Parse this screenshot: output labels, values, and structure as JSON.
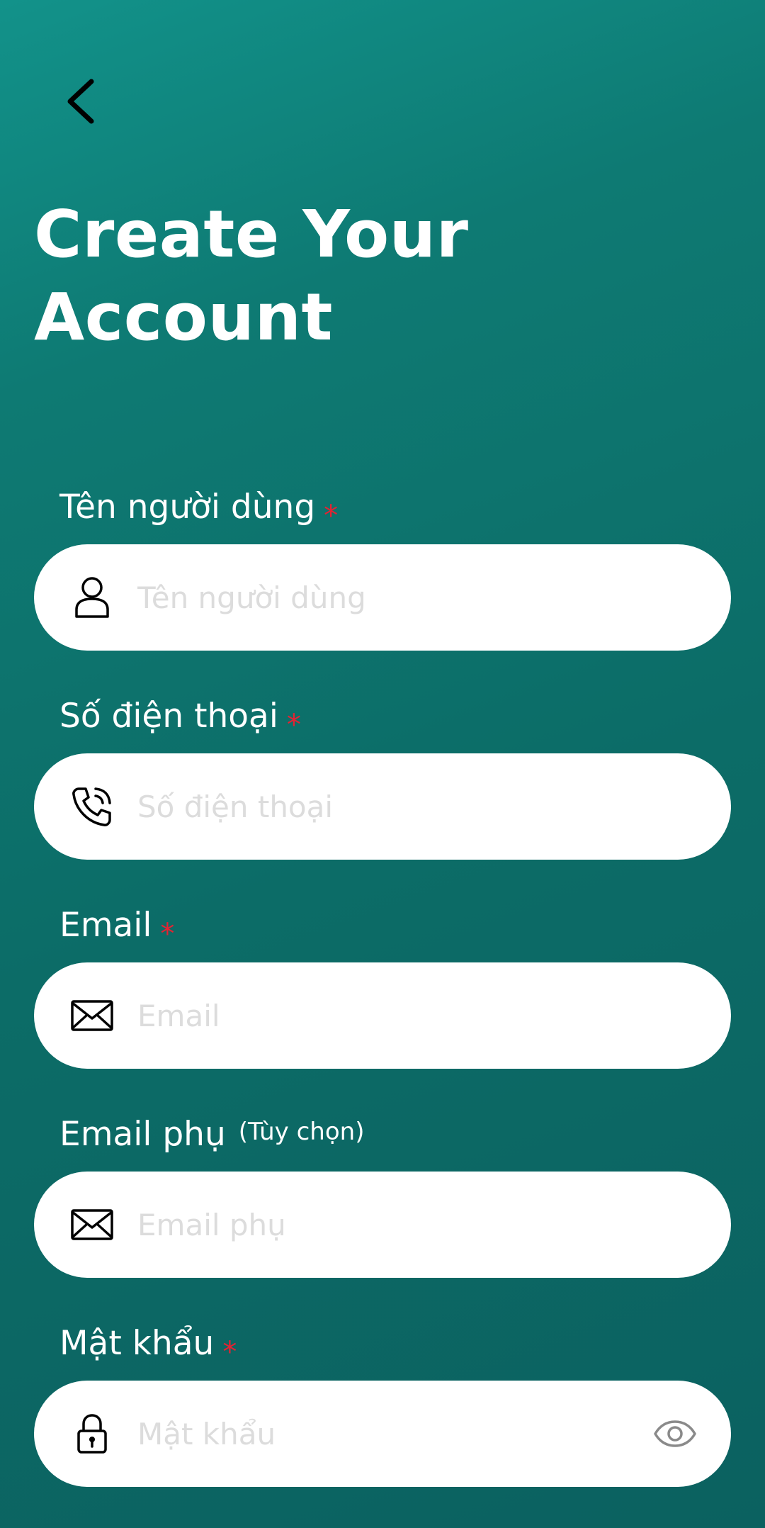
{
  "header": {
    "title_line1": "Create Your",
    "title_line2": "Account"
  },
  "fields": [
    {
      "label": "Tên người dùng",
      "required_mark": "*",
      "placeholder": "Tên người dùng",
      "value": "",
      "icon": "user-icon"
    },
    {
      "label": "Số điện thoại",
      "required_mark": "*",
      "placeholder": "Số điện thoại",
      "value": "",
      "icon": "phone-icon"
    },
    {
      "label": "Email",
      "required_mark": "*",
      "placeholder": "Email",
      "value": "",
      "icon": "mail-icon"
    },
    {
      "label": "Email phụ",
      "optional_note": "(Tùy chọn)",
      "placeholder": "Email phụ",
      "value": "",
      "icon": "mail-icon"
    },
    {
      "label": "Mật khẩu",
      "required_mark": "*",
      "placeholder": "Mật khẩu",
      "value": "",
      "icon": "lock-icon",
      "trailing_icon": "eye-icon"
    }
  ],
  "colors": {
    "background_top": "#12928a",
    "background_bottom": "#0b6160",
    "required": "#e52232",
    "placeholder": "#dcdcdc",
    "input_bg": "#ffffff"
  }
}
